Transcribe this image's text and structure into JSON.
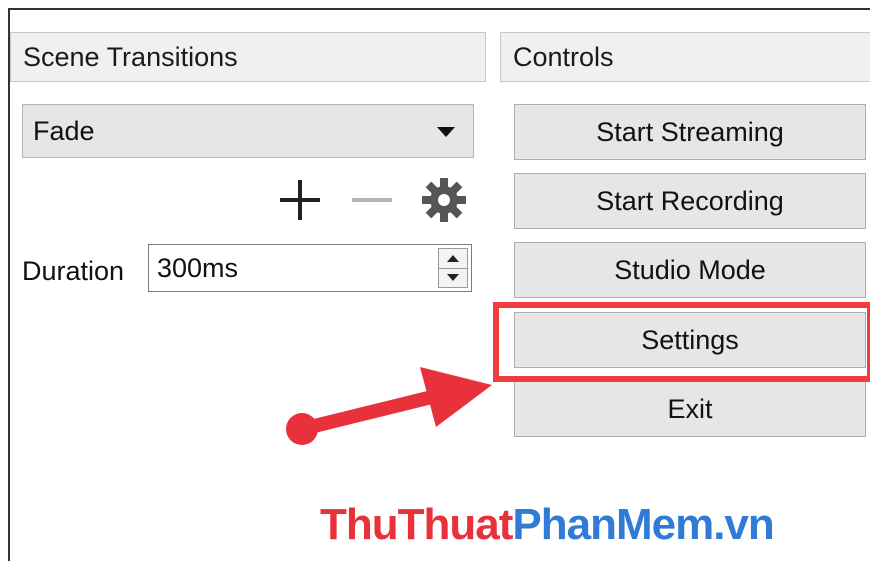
{
  "scene_transitions": {
    "title": "Scene Transitions",
    "transition_selected": "Fade",
    "duration_label": "Duration",
    "duration_value": "300ms",
    "icons": [
      "plus-icon",
      "minus-icon",
      "gear-icon"
    ]
  },
  "controls": {
    "title": "Controls",
    "buttons": [
      "Start Streaming",
      "Start Recording",
      "Studio Mode",
      "Settings",
      "Exit"
    ]
  },
  "annotation": {
    "highlight_color": "#f03c3c",
    "arrow_color": "#e8313a"
  },
  "watermark": {
    "part1": "ThuThuat",
    "part2": "PhanMem.vn",
    "color1": "#e8313a",
    "color2": "#2f7bd6"
  }
}
